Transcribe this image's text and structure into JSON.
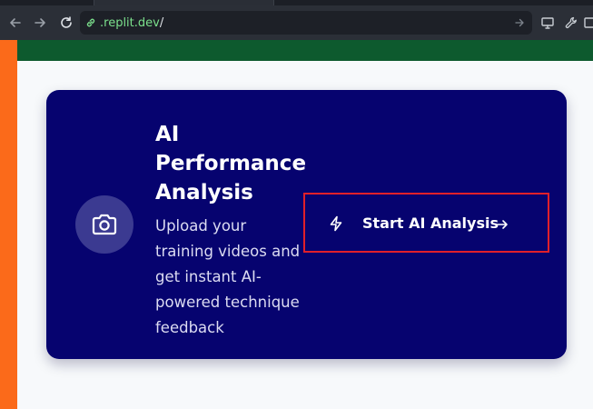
{
  "browser": {
    "url_domain": ".replit.dev",
    "url_slash": "/"
  },
  "card": {
    "title": "AI Performance Analysis",
    "description": "Upload your training videos and get instant AI-powered technique feedback",
    "button_label": "Start AI Analysis"
  },
  "icons": {
    "camera": "camera-icon",
    "bolt": "bolt-icon",
    "arrow": "arrow-right-icon"
  },
  "colors": {
    "card_bg": "#06036f",
    "accent_orange": "#fb6a1a",
    "header_green": "#0d5a2e",
    "highlight_red": "#e0202a"
  }
}
